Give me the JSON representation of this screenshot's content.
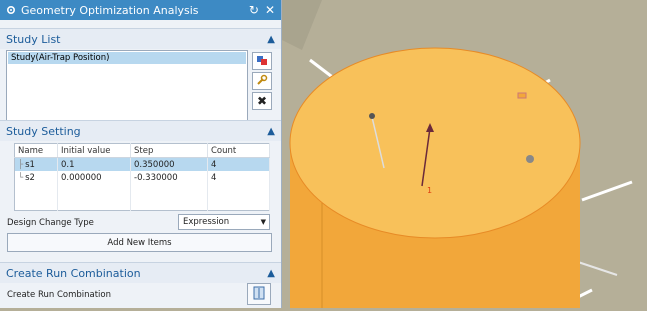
{
  "title": "Geometry Optimization Analysis",
  "study_list": {
    "header": "Study List",
    "items": [
      "Study(Air-Trap Position)"
    ]
  },
  "study_setting": {
    "header": "Study Setting",
    "columns": [
      "Name",
      "Initial value",
      "Step",
      "Count"
    ],
    "rows": [
      {
        "name": "s1",
        "initial": "0.1",
        "step": "0.350000",
        "count": "4"
      },
      {
        "name": "s2",
        "initial": "0.000000",
        "step": "-0.330000",
        "count": "4"
      }
    ],
    "design_change_type_label": "Design Change Type",
    "design_change_type_value": "Expression",
    "add_new_items_label": "Add New Items"
  },
  "create_run": {
    "header": "Create Run Combination",
    "label": "Create Run Combination"
  },
  "viewport": {
    "marker_label": "1"
  },
  "colors": {
    "title_bar": "#3d8ac4",
    "section_text": "#1c5c9a",
    "selection": "#b7d8ef",
    "part_fill": "#f7b94e",
    "background": "#b5af98"
  }
}
